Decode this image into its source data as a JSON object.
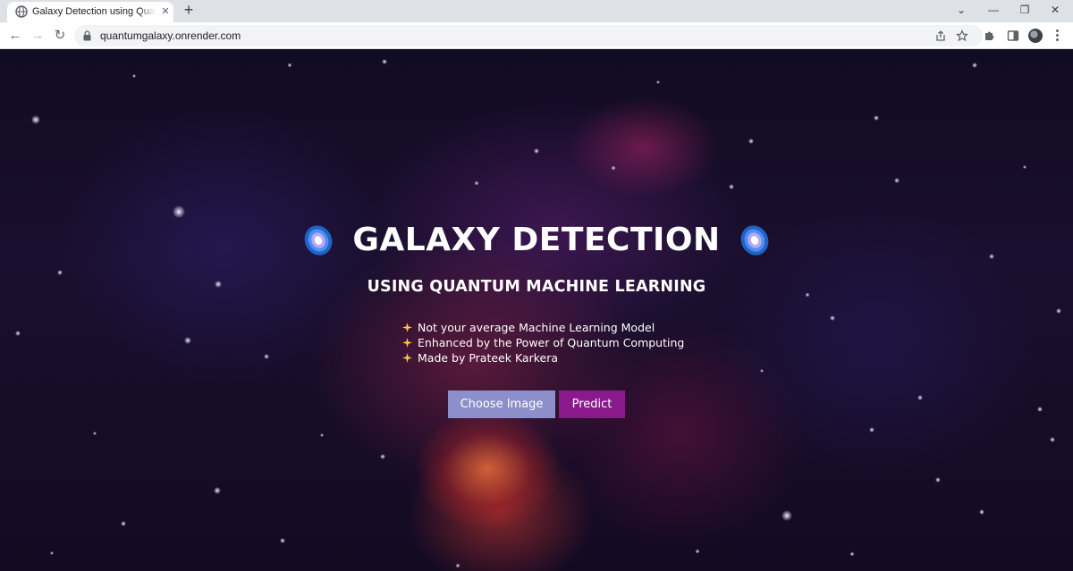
{
  "browser": {
    "tab_title": "Galaxy Detection using Quantum",
    "tab_close": "✕",
    "new_tab": "+",
    "url": "quantumgalaxy.onrender.com"
  },
  "window_controls": {
    "chevron": "⌄",
    "minimize": "—",
    "restore": "❐",
    "close": "✕"
  },
  "nav": {
    "back": "←",
    "forward": "→",
    "reload": "↻"
  },
  "page": {
    "title": "GALAXY DETECTION",
    "subtitle": "USING QUANTUM MACHINE LEARNING",
    "features": [
      "Not your average Machine Learning Model",
      "Enhanced by the Power of Quantum Computing",
      "Made by Prateek Karkera"
    ],
    "choose_button": "Choose Image",
    "predict_button": "Predict"
  },
  "colors": {
    "choose_button": "#8c8fc9",
    "predict_button": "#8a1a8c",
    "background": "#140a22"
  },
  "icons": {
    "title_left": "galaxy-emoji-icon",
    "title_right": "galaxy-emoji-icon",
    "bullet": "sparkle-icon"
  }
}
